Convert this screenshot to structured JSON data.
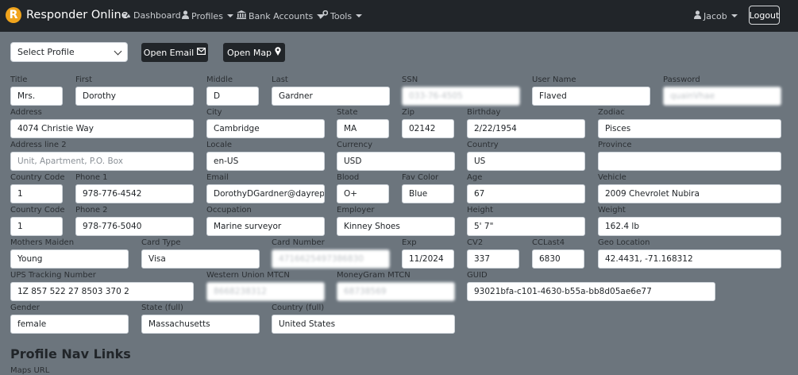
{
  "navbar": {
    "brand_letter": "R",
    "brand_name": "Responder Online",
    "items": [
      {
        "label": "Dashboard",
        "icon": "dashboard-icon"
      },
      {
        "label": "Profiles",
        "icon": "user-icon"
      },
      {
        "label": "Bank Accounts",
        "icon": "bank-icon"
      },
      {
        "label": "Tools",
        "icon": "wrench-icon"
      }
    ],
    "user": "Jacob",
    "logout": "Logout"
  },
  "toolbar": {
    "select_profile": "Select Profile",
    "open_email": "Open Email",
    "open_map": "Open Map"
  },
  "fields": {
    "title": {
      "label": "Title",
      "value": "Mrs."
    },
    "first": {
      "label": "First",
      "value": "Dorothy"
    },
    "middle": {
      "label": "Middle",
      "value": "D"
    },
    "last": {
      "label": "Last",
      "value": "Gardner"
    },
    "ssn": {
      "label": "SSN",
      "value": "033-76-4505"
    },
    "username": {
      "label": "User Name",
      "value": "Flaved"
    },
    "password": {
      "label": "Password",
      "value": "quainVhae"
    },
    "address": {
      "label": "Address",
      "value": "4074 Christie Way"
    },
    "city": {
      "label": "City",
      "value": "Cambridge"
    },
    "state": {
      "label": "State",
      "value": "MA"
    },
    "zip": {
      "label": "Zip",
      "value": "02142"
    },
    "birthday": {
      "label": "Birthday",
      "value": "2/22/1954"
    },
    "zodiac": {
      "label": "Zodiac",
      "value": "Pisces"
    },
    "address2": {
      "label": "Address line 2",
      "placeholder": "Unit, Apartment, P.O. Box"
    },
    "locale": {
      "label": "Locale",
      "value": "en-US"
    },
    "currency": {
      "label": "Currency",
      "value": "USD"
    },
    "country": {
      "label": "Country",
      "value": "US"
    },
    "province": {
      "label": "Province",
      "value": ""
    },
    "cc1": {
      "label": "Country Code",
      "value": "1"
    },
    "phone1": {
      "label": "Phone 1",
      "value": "978-776-4542"
    },
    "email": {
      "label": "Email",
      "value": "DorothyDGardner@dayrep.c"
    },
    "blood": {
      "label": "Blood",
      "value": "O+"
    },
    "favcolor": {
      "label": "Fav Color",
      "value": "Blue"
    },
    "age": {
      "label": "Age",
      "value": "67"
    },
    "vehicle": {
      "label": "Vehicle",
      "value": "2009 Chevrolet Nubira"
    },
    "cc2": {
      "label": "Country Code",
      "value": "1"
    },
    "phone2": {
      "label": "Phone 2",
      "value": "978-776-5040"
    },
    "occupation": {
      "label": "Occupation",
      "value": "Marine surveyor"
    },
    "employer": {
      "label": "Employer",
      "value": "Kinney Shoes"
    },
    "height": {
      "label": "Height",
      "value": "5' 7\""
    },
    "weight": {
      "label": "Weight",
      "value": "162.4 lb"
    },
    "maiden": {
      "label": "Mothers Maiden",
      "value": "Young"
    },
    "cardtype": {
      "label": "Card Type",
      "value": "Visa"
    },
    "cardnum": {
      "label": "Card Number",
      "value": "4716625497386830"
    },
    "exp": {
      "label": "Exp",
      "value": "11/2024"
    },
    "cv2": {
      "label": "CV2",
      "value": "337"
    },
    "cclast4": {
      "label": "CCLast4",
      "value": "6830"
    },
    "geo": {
      "label": "Geo Location",
      "value": "42.4431, -71.168312"
    },
    "ups": {
      "label": "UPS Tracking Number",
      "value": "1Z 857 522 27 8503 370 2"
    },
    "wu": {
      "label": "Western Union MTCN",
      "value": "8668238312"
    },
    "mg": {
      "label": "MoneyGram MTCN",
      "value": "68738569"
    },
    "guid": {
      "label": "GUID",
      "value": "93021bfa-c101-4630-b55a-bb8d05ae6e77"
    },
    "gender": {
      "label": "Gender",
      "value": "female"
    },
    "statefull": {
      "label": "State (full)",
      "value": "Massachusetts"
    },
    "countryfull": {
      "label": "Country (full)",
      "value": "United States"
    }
  },
  "section": {
    "title": "Profile Nav Links",
    "sub_label": "Maps URL"
  }
}
